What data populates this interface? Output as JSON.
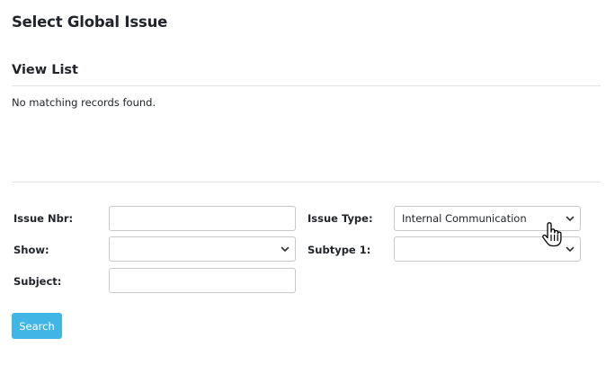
{
  "page": {
    "title": "Select Global Issue"
  },
  "view_list": {
    "title": "View List",
    "empty_message": "No matching records found."
  },
  "form": {
    "issue_nbr": {
      "label": "Issue Nbr:",
      "value": ""
    },
    "show": {
      "label": "Show:",
      "value": ""
    },
    "subject": {
      "label": "Subject:",
      "value": ""
    },
    "issue_type": {
      "label": "Issue Type:",
      "value": "Internal Communication"
    },
    "subtype_1": {
      "label": "Subtype 1:",
      "value": ""
    },
    "search_label": "Search"
  },
  "colors": {
    "accent": "#41b6e6",
    "divider": "#e3e3e3",
    "input_border": "#c9c9c9"
  },
  "icons": {
    "select_arrow": "chevron-down-icon",
    "pointer": "hand-pointer-cursor-icon"
  }
}
